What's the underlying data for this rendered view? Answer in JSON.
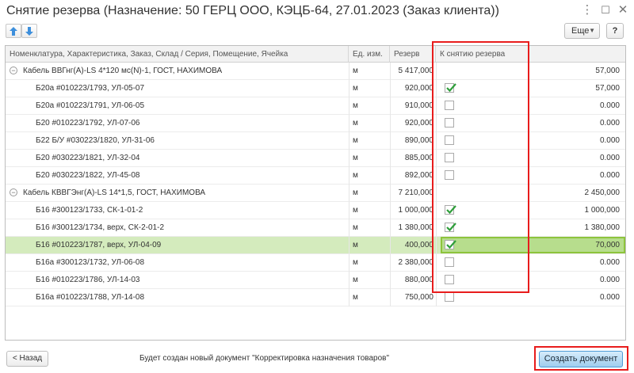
{
  "window": {
    "title": "Снятие резерва (Назначение: 50 ГЕРЦ ООО, КЭЦБ-64, 27.01.2023 (Заказ клиента))",
    "controls": {
      "more": "⋮",
      "maximize": "☐",
      "close": "✕"
    }
  },
  "toolbar": {
    "up_icon": "arrow-up-icon",
    "down_icon": "arrow-down-icon",
    "more_label": "Еще",
    "help_label": "?"
  },
  "table": {
    "columns": {
      "name": "Номенклатура, Характеристика, Заказ, Склад / Серия, Помещение, Ячейка",
      "unit": "Ед. изм.",
      "reserve": "Резерв",
      "remove": "К снятию резерва"
    },
    "rows": [
      {
        "type": "group",
        "name": "Кабель ВВГнг(А)-LS 4*120 мс(N)-1, ГОСТ, НАХИМОВА",
        "unit": "м",
        "reserve": "5 417,000",
        "amount": "57,000"
      },
      {
        "type": "item",
        "name": "Б20а #010223/1793, УЛ-05-07",
        "unit": "м",
        "reserve": "920,000",
        "checked": true,
        "amount": "57,000"
      },
      {
        "type": "item",
        "name": "Б20а #010223/1791, УЛ-06-05",
        "unit": "м",
        "reserve": "910,000",
        "checked": false,
        "amount": "0.000"
      },
      {
        "type": "item",
        "name": "Б20 #010223/1792, УЛ-07-06",
        "unit": "м",
        "reserve": "920,000",
        "checked": false,
        "amount": "0.000"
      },
      {
        "type": "item",
        "name": "Б22 Б/У #030223/1820, УЛ-31-06",
        "unit": "м",
        "reserve": "890,000",
        "checked": false,
        "amount": "0.000"
      },
      {
        "type": "item",
        "name": "Б20 #030223/1821, УЛ-32-04",
        "unit": "м",
        "reserve": "885,000",
        "checked": false,
        "amount": "0.000"
      },
      {
        "type": "item",
        "name": "Б20 #030223/1822, УЛ-45-08",
        "unit": "м",
        "reserve": "892,000",
        "checked": false,
        "amount": "0.000"
      },
      {
        "type": "group",
        "name": "Кабель КВВГЭнг(А)-LS 14*1,5, ГОСТ, НАХИМОВА",
        "unit": "м",
        "reserve": "7 210,000",
        "amount": "2 450,000"
      },
      {
        "type": "item",
        "name": "Б16 #300123/1733, СК-1-01-2",
        "unit": "м",
        "reserve": "1 000,000",
        "checked": true,
        "amount": "1 000,000"
      },
      {
        "type": "item",
        "name": "Б16 #300123/1734, верх, СК-2-01-2",
        "unit": "м",
        "reserve": "1 380,000",
        "checked": true,
        "amount": "1 380,000"
      },
      {
        "type": "item",
        "name": "Б16 #010223/1787, верх, УЛ-04-09",
        "unit": "м",
        "reserve": "400,000",
        "checked": true,
        "amount": "70,000",
        "selected": true
      },
      {
        "type": "item",
        "name": "Б16а #300123/1732, УЛ-06-08",
        "unit": "м",
        "reserve": "2 380,000",
        "checked": false,
        "amount": "0.000"
      },
      {
        "type": "item",
        "name": "Б16 #010223/1786, УЛ-14-03",
        "unit": "м",
        "reserve": "880,000",
        "checked": false,
        "amount": "0.000"
      },
      {
        "type": "item",
        "name": "Б16а #010223/1788, УЛ-14-08",
        "unit": "м",
        "reserve": "750,000",
        "checked": false,
        "amount": "0.000"
      }
    ]
  },
  "footer": {
    "back_label": "< Назад",
    "info_text": "Будет создан новый документ \"Корректировка назначения товаров\"",
    "create_label": "Создать документ"
  },
  "colors": {
    "selected_row": "#d4ebbd",
    "highlight": "#e81c1c",
    "primary_button": "#9fcdee",
    "checkmark": "#2e9e3a"
  }
}
